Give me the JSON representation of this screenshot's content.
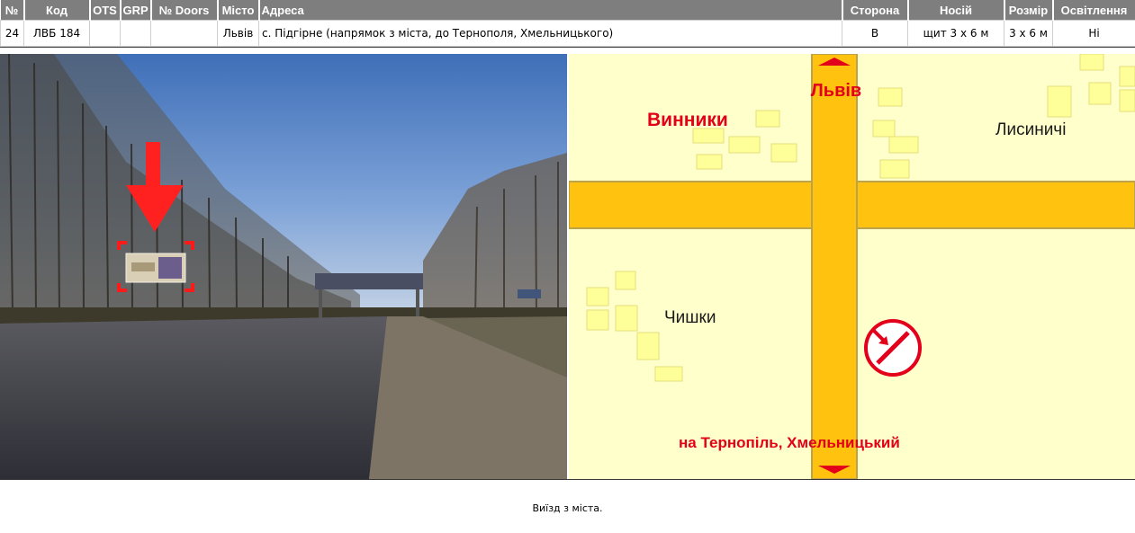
{
  "table": {
    "headers": [
      "№",
      "Код",
      "OTS",
      "GRP",
      "№ Doors",
      "Місто",
      "Адреса",
      "Сторона",
      "Носій",
      "Розмір",
      "Освітлення"
    ],
    "row": {
      "num": "24",
      "code": "ЛВБ 184",
      "ots": "",
      "grp": "",
      "doors": "",
      "city": "Львів",
      "address": "с. Підгірне (напрямок з міста, до Тернополя, Хмельницького)",
      "side": "B",
      "carrier": "щит 3 х 6 м",
      "size": "3 х 6 м",
      "lighting": "Ні"
    }
  },
  "map": {
    "label_lviv": "Львів",
    "label_vynnyky": "Винники",
    "label_lysynychi": "Лисиничі",
    "label_chyshky": "Чишки",
    "label_direction": "на Тернопіль, Хмельницький",
    "colors": {
      "background": "#ffffcc",
      "road": "#ffc20e",
      "building": "#ffff99",
      "marker": "#e3001b",
      "road_edge": "#bca24a"
    }
  },
  "photo": {
    "icons": [
      "red-arrow-icon",
      "billboard-marker-icon"
    ]
  },
  "caption": "Виїзд з міста."
}
